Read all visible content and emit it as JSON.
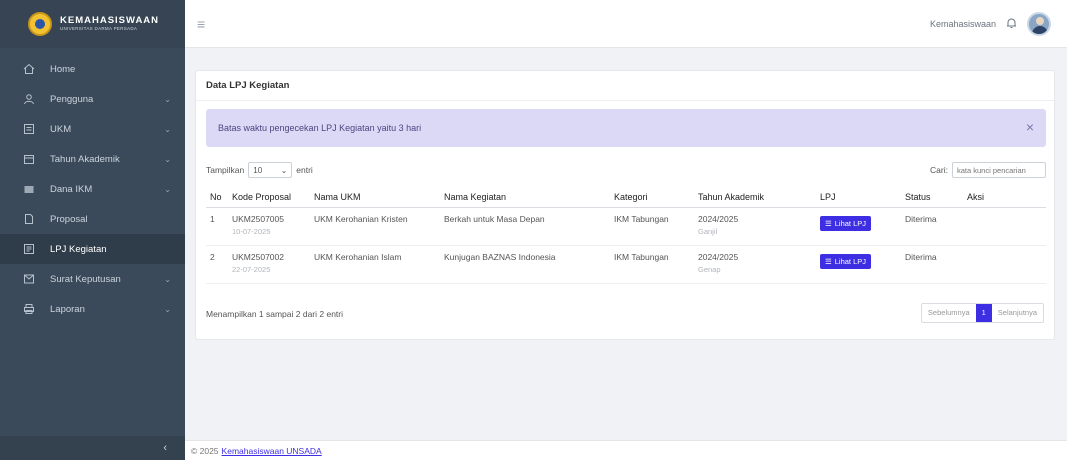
{
  "brand": {
    "title": "KEMAHASISWAAN",
    "subtitle": "UNIVERSITAS DARMA PERSADA"
  },
  "menu": [
    {
      "label": "Home",
      "icon": "home-icon",
      "has_children": false
    },
    {
      "label": "Pengguna",
      "icon": "user-icon",
      "has_children": true
    },
    {
      "label": "UKM",
      "icon": "ukm-icon",
      "has_children": true
    },
    {
      "label": "Tahun Akademik",
      "icon": "calendar-icon",
      "has_children": true
    },
    {
      "label": "Dana IKM",
      "icon": "wallet-icon",
      "has_children": true
    },
    {
      "label": "Proposal",
      "icon": "document-icon",
      "has_children": false
    },
    {
      "label": "LPJ Kegiatan",
      "icon": "report-icon",
      "has_children": false,
      "active": true
    },
    {
      "label": "Surat Keputusan",
      "icon": "letter-icon",
      "has_children": true
    },
    {
      "label": "Laporan",
      "icon": "print-icon",
      "has_children": true
    }
  ],
  "sidebar_toggle": "‹",
  "topbar": {
    "user_name": "Kemahasiswaan"
  },
  "card": {
    "title": "Data LPJ Kegiatan"
  },
  "alert": {
    "text": "Batas waktu pengecekan LPJ Kegiatan yaitu 3 hari",
    "close": "×"
  },
  "controls": {
    "show_prefix": "Tampilkan",
    "length_value": "10",
    "show_suffix": "entri",
    "search_label": "Cari:",
    "search_placeholder": "kata kunci pencarian"
  },
  "table": {
    "headers": [
      "No",
      "Kode Proposal",
      "Nama UKM",
      "Nama Kegiatan",
      "Kategori",
      "Tahun Akademik",
      "LPJ",
      "Status",
      "Aksi"
    ],
    "rows": [
      {
        "no": "1",
        "kode": "UKM2507005",
        "tanggal": "10-07-2025",
        "ukm": "UKM Kerohanian Kristen",
        "kegiatan": "Berkah untuk Masa Depan",
        "kategori": "IKM Tabungan",
        "tahun": "2024/2025",
        "semester": "Ganjil",
        "lpj_button": "Lihat LPJ",
        "status": "Diterima"
      },
      {
        "no": "2",
        "kode": "UKM2507002",
        "tanggal": "22-07-2025",
        "ukm": "UKM Kerohanian Islam",
        "kegiatan": "Kunjugan BAZNAS Indonesia",
        "kategori": "IKM Tabungan",
        "tahun": "2024/2025",
        "semester": "Genap",
        "lpj_button": "Lihat LPJ",
        "status": "Diterima"
      }
    ]
  },
  "info": "Menampilkan 1 sampai 2 dari 2 entri",
  "pagination": {
    "prev": "Sebelumnya",
    "current": "1",
    "next": "Selanjutnya"
  },
  "footer": {
    "copyright": "© 2025",
    "link": "Kemahasiswaan UNSADA"
  },
  "colors": {
    "sidebar": "#3b4a5a",
    "primary": "#3d2de3",
    "alert_bg": "#dcd9f7"
  }
}
